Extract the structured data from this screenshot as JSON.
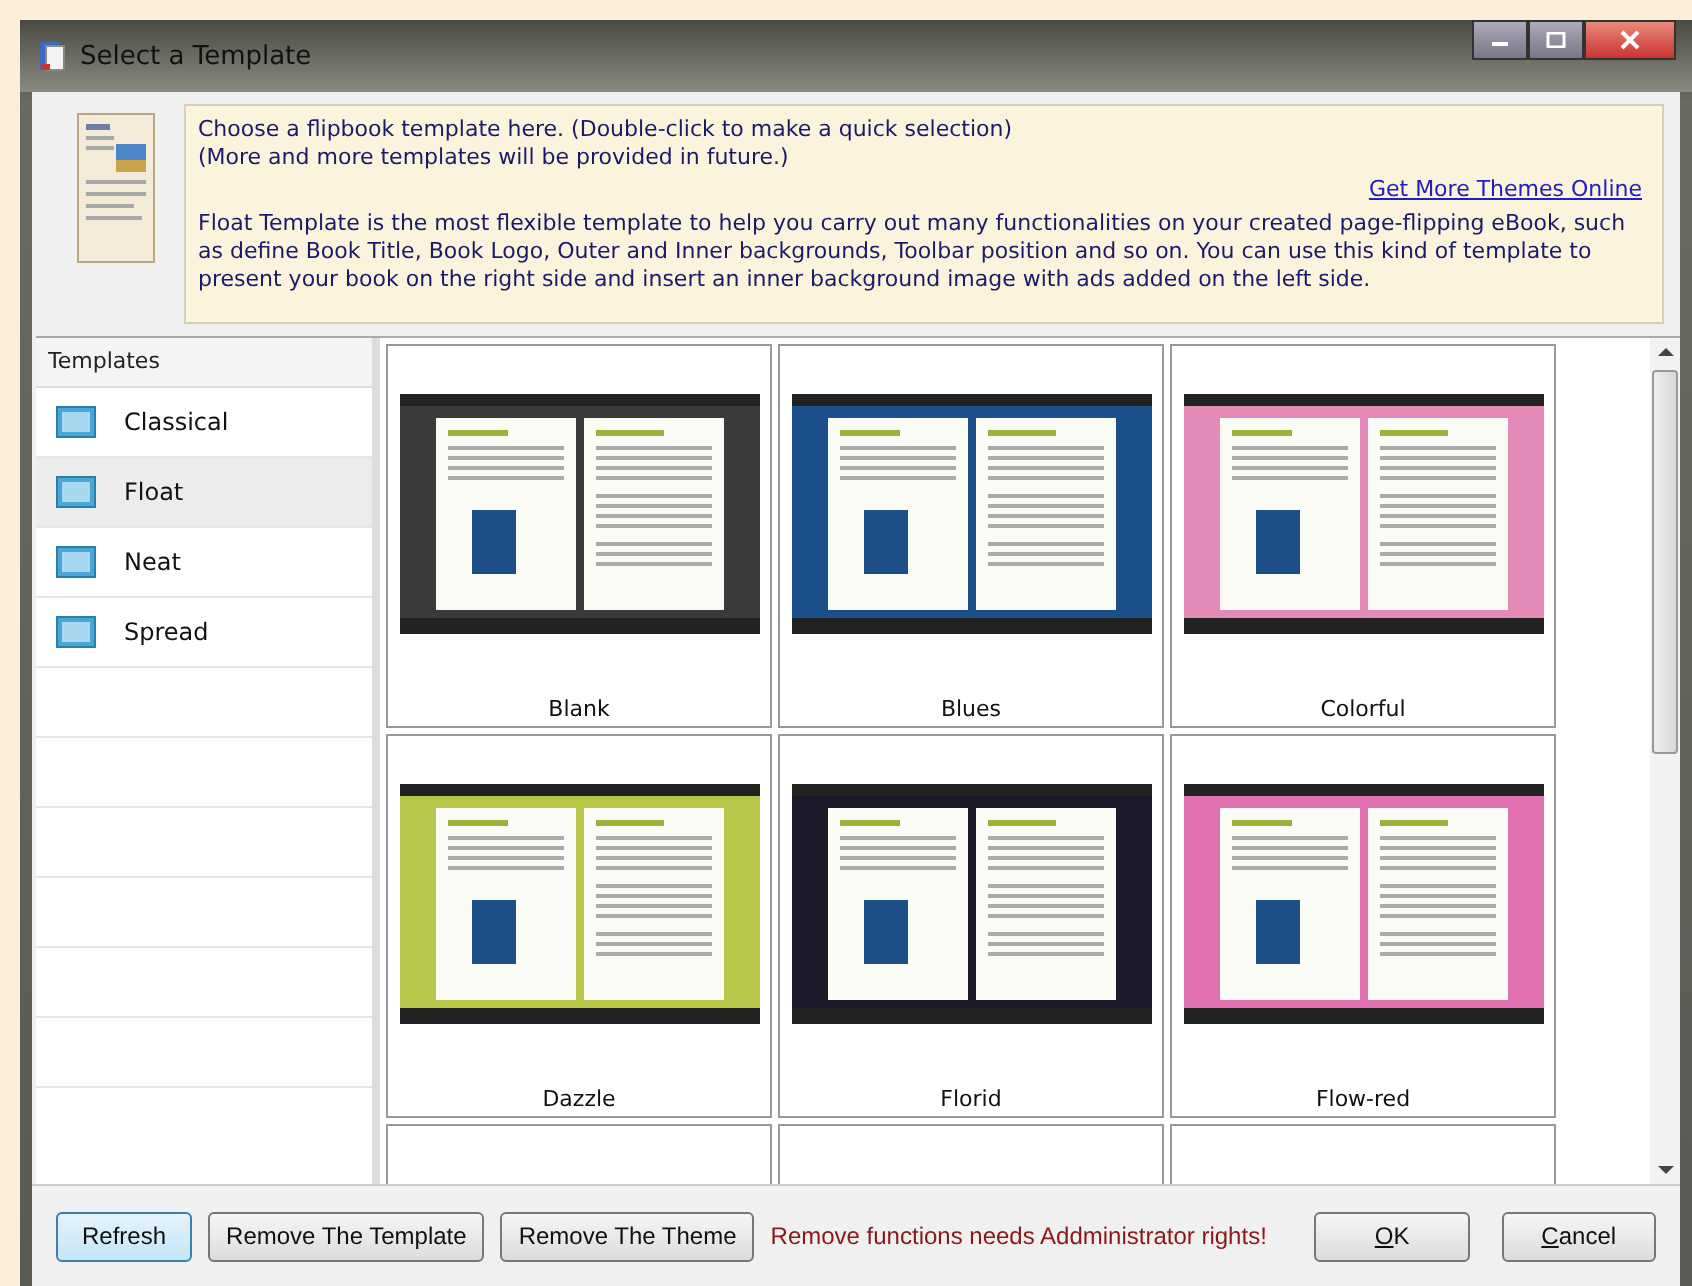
{
  "window": {
    "title": "Select a Template"
  },
  "info": {
    "lines": [
      "Choose a flipbook template here. (Double-click to make a quick selection)",
      "(More and more templates will be provided in future.)"
    ],
    "link": "Get More Themes Online",
    "description": "Float Template is the most flexible template to help you carry out many functionalities on your created page-flipping eBook, such as define Book Title, Book Logo, Outer and Inner backgrounds, Toolbar position and so on. You can use this kind of template to present your book on the right side and insert an inner background image with ads added on the left side."
  },
  "sidebar": {
    "header": "Templates",
    "items": [
      {
        "label": "Classical",
        "selected": false
      },
      {
        "label": "Float",
        "selected": true
      },
      {
        "label": "Neat",
        "selected": false
      },
      {
        "label": "Spread",
        "selected": false
      }
    ]
  },
  "themes": [
    {
      "name": "Blank",
      "color": "#3a3a3a"
    },
    {
      "name": "Blues",
      "color": "#1a4f8a"
    },
    {
      "name": "Colorful",
      "color": "#e48ab8"
    },
    {
      "name": "Dazzle",
      "color": "#b8c64a"
    },
    {
      "name": "Florid",
      "color": "#1a1a2a"
    },
    {
      "name": "Flow-red",
      "color": "#e070b0"
    }
  ],
  "buttons": {
    "left": [
      "Refresh",
      "Remove The Template",
      "Remove The Theme"
    ],
    "warning": "Remove functions needs Addministrator rights!",
    "right": [
      "OK",
      "Cancel"
    ]
  }
}
